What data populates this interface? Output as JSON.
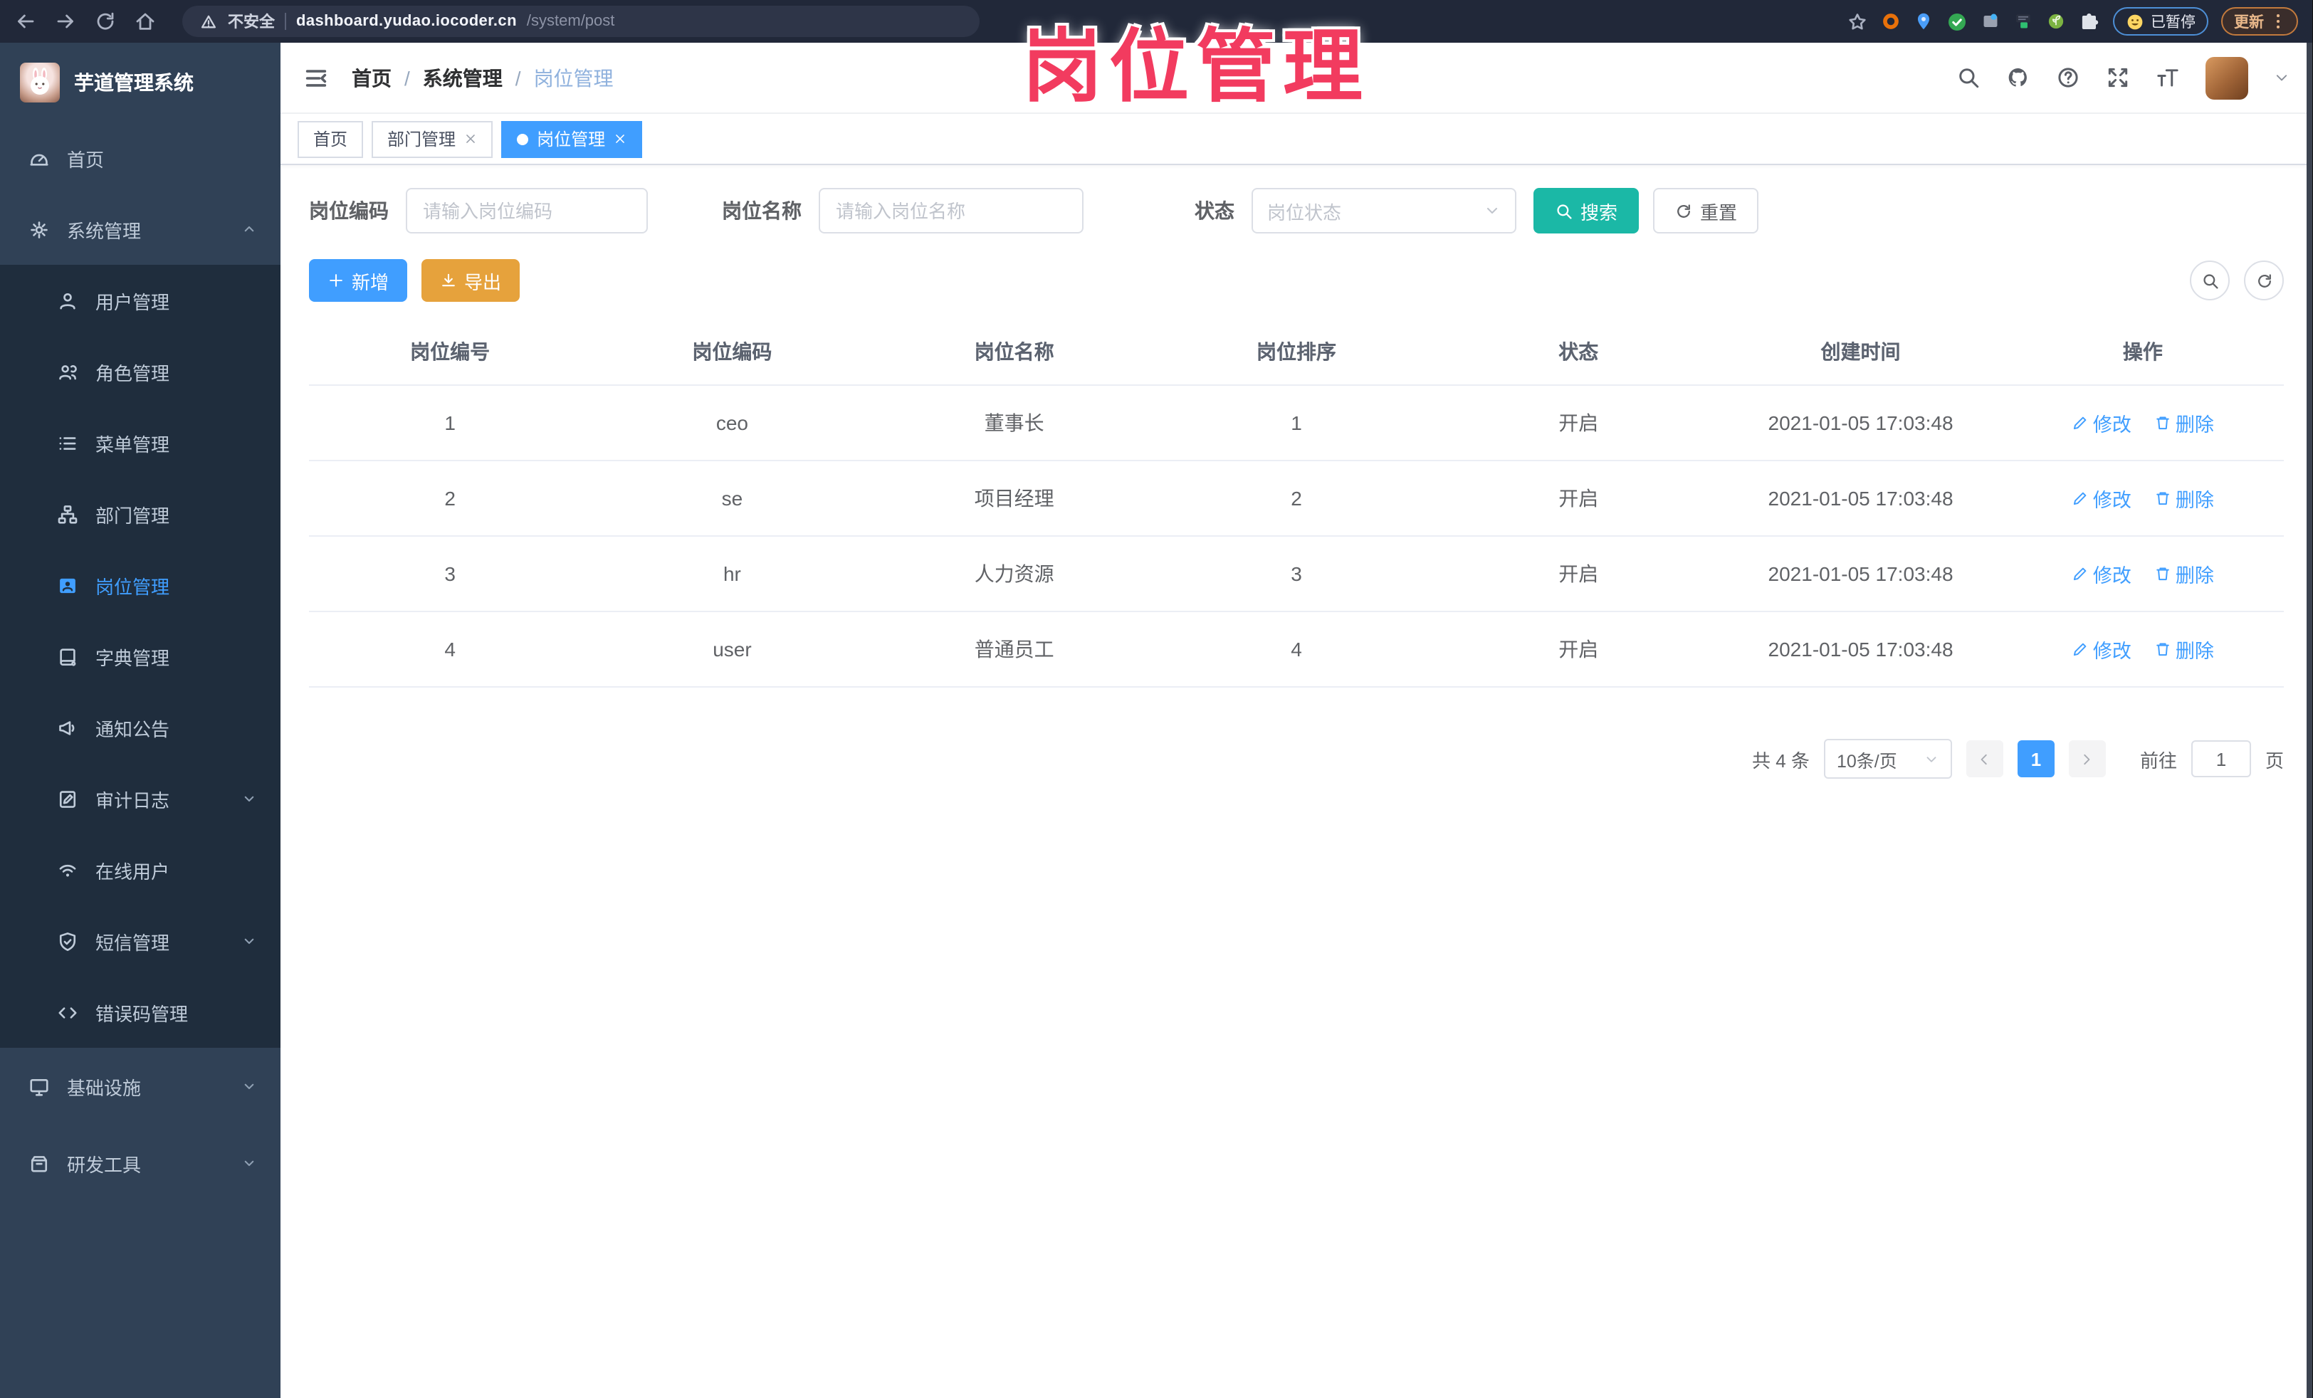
{
  "browser": {
    "security_label": "不安全",
    "url_host": "dashboard.yudao.iocoder.cn",
    "url_path": "/system/post",
    "paused_label": "已暂停",
    "update_label": "更新"
  },
  "overlay_title": "岗位管理",
  "sidebar": {
    "logo_title": "芋道管理系统",
    "items": [
      {
        "label": "首页"
      },
      {
        "label": "系统管理"
      },
      {
        "label": "用户管理"
      },
      {
        "label": "角色管理"
      },
      {
        "label": "菜单管理"
      },
      {
        "label": "部门管理"
      },
      {
        "label": "岗位管理"
      },
      {
        "label": "字典管理"
      },
      {
        "label": "通知公告"
      },
      {
        "label": "审计日志"
      },
      {
        "label": "在线用户"
      },
      {
        "label": "短信管理"
      },
      {
        "label": "错误码管理"
      },
      {
        "label": "基础设施"
      },
      {
        "label": "研发工具"
      }
    ]
  },
  "header": {
    "breadcrumb": [
      "首页",
      "系统管理",
      "岗位管理"
    ]
  },
  "tabs": [
    {
      "label": "首页"
    },
    {
      "label": "部门管理"
    },
    {
      "label": "岗位管理"
    }
  ],
  "filters": {
    "post_code_label": "岗位编码",
    "post_code_placeholder": "请输入岗位编码",
    "post_name_label": "岗位名称",
    "post_name_placeholder": "请输入岗位名称",
    "status_label": "状态",
    "status_placeholder": "岗位状态",
    "search_label": "搜索",
    "reset_label": "重置"
  },
  "toolbar": {
    "add_label": "新增",
    "export_label": "导出"
  },
  "table": {
    "headers": [
      "岗位编号",
      "岗位编码",
      "岗位名称",
      "岗位排序",
      "状态",
      "创建时间",
      "操作"
    ],
    "edit_label": "修改",
    "delete_label": "删除",
    "rows": [
      {
        "id": "1",
        "code": "ceo",
        "name": "董事长",
        "order": "1",
        "status": "开启",
        "created": "2021-01-05 17:03:48"
      },
      {
        "id": "2",
        "code": "se",
        "name": "项目经理",
        "order": "2",
        "status": "开启",
        "created": "2021-01-05 17:03:48"
      },
      {
        "id": "3",
        "code": "hr",
        "name": "人力资源",
        "order": "3",
        "status": "开启",
        "created": "2021-01-05 17:03:48"
      },
      {
        "id": "4",
        "code": "user",
        "name": "普通员工",
        "order": "4",
        "status": "开启",
        "created": "2021-01-05 17:03:48"
      }
    ]
  },
  "pagination": {
    "total_label": "共 4 条",
    "page_size": "10条/页",
    "current_page": "1",
    "goto_prefix": "前往",
    "goto_value": "1",
    "goto_suffix": "页"
  },
  "colors": {
    "primary": "#409EFF",
    "search_button": "#1BB8A6",
    "export_button": "#E6A23C",
    "overlay_title": "#F23B5F",
    "sidebar_bg": "#304156",
    "submenu_bg": "#1F2D3D",
    "chrome_bg": "#212839"
  }
}
